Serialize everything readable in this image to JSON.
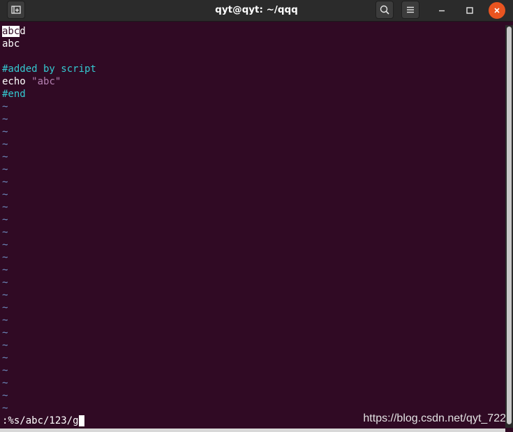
{
  "window": {
    "title": "qyt@qyt: ~/qqq",
    "new_tab_icon": "new-tab-icon",
    "search_icon": "search-icon",
    "menu_icon": "hamburger-menu-icon",
    "minimize_icon": "minimize-icon",
    "maximize_icon": "maximize-icon",
    "close_icon": "close-icon",
    "close_color": "#e95420"
  },
  "editor": {
    "background": "#300a24",
    "line1": {
      "highlighted": "abc",
      "cursor_char": "d",
      "rest": ""
    },
    "line2": "abc",
    "line3": "",
    "line4": "#added by script",
    "line5": {
      "cmd": "echo ",
      "string": "\"abc\""
    },
    "line6": "#end",
    "tilde": "~",
    "tilde_count": 25,
    "command_line": ":%s/abc/123/g"
  },
  "watermark": "https://blog.csdn.net/qyt_722",
  "colors": {
    "comment": "#34c9d1",
    "string": "#b37fb0",
    "tilde": "#6e8ec2"
  }
}
